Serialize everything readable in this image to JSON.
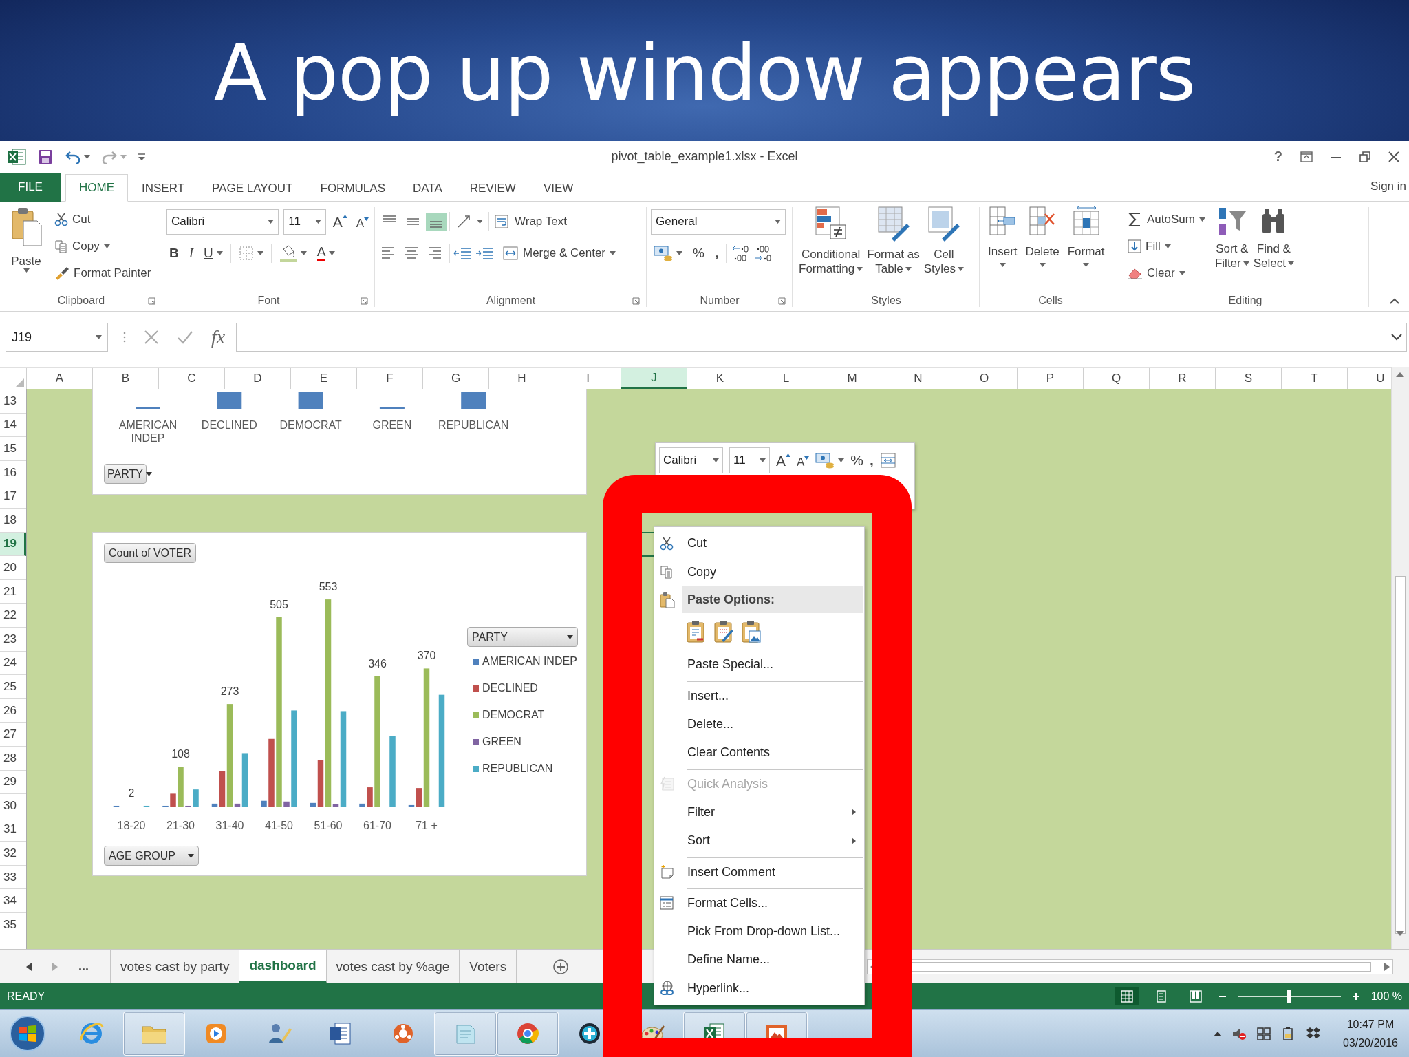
{
  "slide": {
    "title": "A pop up window appears"
  },
  "window": {
    "title": "pivot_table_example1.xlsx - Excel",
    "help": "?"
  },
  "ribbon_tabs": [
    {
      "label": "FILE",
      "kind": "file",
      "selected": false
    },
    {
      "label": "HOME",
      "kind": "tab",
      "selected": true
    },
    {
      "label": "INSERT",
      "kind": "tab",
      "selected": false
    },
    {
      "label": "PAGE LAYOUT",
      "kind": "tab",
      "selected": false
    },
    {
      "label": "FORMULAS",
      "kind": "tab",
      "selected": false
    },
    {
      "label": "DATA",
      "kind": "tab",
      "selected": false
    },
    {
      "label": "REVIEW",
      "kind": "tab",
      "selected": false
    },
    {
      "label": "VIEW",
      "kind": "tab",
      "selected": false
    }
  ],
  "account": {
    "sign_in": "Sign in"
  },
  "ribbon": {
    "clipboard": {
      "label": "Clipboard",
      "paste": "Paste",
      "cut": "Cut",
      "copy": "Copy",
      "format_painter": "Format Painter"
    },
    "font": {
      "label": "Font",
      "font_name": "Calibri",
      "font_size": "11",
      "grow": "A",
      "shrink": "A",
      "bold": "B",
      "italic": "I",
      "underline": "U",
      "font_color": "A"
    },
    "alignment": {
      "label": "Alignment",
      "vertical_align": [
        {
          "selected": false
        },
        {
          "selected": false
        },
        {
          "selected": true
        }
      ],
      "wrap_text": "Wrap Text",
      "merge_center": "Merge & Center"
    },
    "number": {
      "label": "Number",
      "format": "General",
      "percent": "%",
      "comma": ","
    },
    "styles": {
      "label": "Styles",
      "buttons": [
        {
          "lines": [
            "Conditional",
            "Formatting"
          ]
        },
        {
          "lines": [
            "Format as",
            "Table"
          ]
        },
        {
          "lines": [
            "Cell",
            "Styles"
          ]
        }
      ]
    },
    "cells": {
      "label": "Cells",
      "buttons": [
        "Insert",
        "Delete",
        "Format"
      ]
    },
    "editing": {
      "label": "Editing",
      "autosum": "AutoSum",
      "fill": "Fill",
      "clear": "Clear",
      "sort_filter": [
        "Sort &",
        "Filter"
      ],
      "find_select": [
        "Find &",
        "Select"
      ]
    }
  },
  "formula_bar": {
    "name_box": "J19",
    "function_label": "fx"
  },
  "sheet": {
    "columns": [
      {
        "label": "A",
        "selected": false
      },
      {
        "label": "B",
        "selected": false
      },
      {
        "label": "C",
        "selected": false
      },
      {
        "label": "D",
        "selected": false
      },
      {
        "label": "E",
        "selected": false
      },
      {
        "label": "F",
        "selected": false
      },
      {
        "label": "G",
        "selected": false
      },
      {
        "label": "H",
        "selected": false
      },
      {
        "label": "I",
        "selected": false
      },
      {
        "label": "J",
        "selected": true
      },
      {
        "label": "K",
        "selected": false
      },
      {
        "label": "L",
        "selected": false
      },
      {
        "label": "M",
        "selected": false
      },
      {
        "label": "N",
        "selected": false
      },
      {
        "label": "O",
        "selected": false
      },
      {
        "label": "P",
        "selected": false
      },
      {
        "label": "Q",
        "selected": false
      },
      {
        "label": "R",
        "selected": false
      },
      {
        "label": "S",
        "selected": false
      },
      {
        "label": "T",
        "selected": false
      },
      {
        "label": "U",
        "selected": false
      }
    ],
    "rows": [
      {
        "label": "13",
        "selected": false
      },
      {
        "label": "14",
        "selected": false
      },
      {
        "label": "15",
        "selected": false
      },
      {
        "label": "16",
        "selected": false
      },
      {
        "label": "17",
        "selected": false
      },
      {
        "label": "18",
        "selected": false
      },
      {
        "label": "19",
        "selected": true
      },
      {
        "label": "20",
        "selected": false
      },
      {
        "label": "21",
        "selected": false
      },
      {
        "label": "22",
        "selected": false
      },
      {
        "label": "23",
        "selected": false
      },
      {
        "label": "24",
        "selected": false
      },
      {
        "label": "25",
        "selected": false
      },
      {
        "label": "26",
        "selected": false
      },
      {
        "label": "27",
        "selected": false
      },
      {
        "label": "28",
        "selected": false
      },
      {
        "label": "29",
        "selected": false
      },
      {
        "label": "30",
        "selected": false
      },
      {
        "label": "31",
        "selected": false
      },
      {
        "label": "32",
        "selected": false
      },
      {
        "label": "33",
        "selected": false
      },
      {
        "label": "34",
        "selected": false
      },
      {
        "label": "35",
        "selected": false
      }
    ]
  },
  "party_chart": {
    "filter_button": "PARTY",
    "categories": [
      {
        "label": "AMERICAN INDEP",
        "kind": "thin"
      },
      {
        "label": "DECLINED",
        "kind": "block"
      },
      {
        "label": "DEMOCRAT",
        "kind": "block"
      },
      {
        "label": "GREEN",
        "kind": "thin"
      },
      {
        "label": "REPUBLICAN",
        "kind": "block"
      }
    ]
  },
  "age_chart": {
    "value_button": "Count of VOTER",
    "legend_button": "PARTY",
    "axis_button": "AGE GROUP",
    "categories": [
      "18-20",
      "21-30",
      "31-40",
      "41-50",
      "51-60",
      "61-70",
      "71 +"
    ],
    "legend": [
      {
        "name": "AMERICAN INDEP",
        "color": "#4f81bd"
      },
      {
        "name": "DECLINED",
        "color": "#c0504d"
      },
      {
        "name": "DEMOCRAT",
        "color": "#9bbb59"
      },
      {
        "name": "GREEN",
        "color": "#8064a2"
      },
      {
        "name": "REPUBLICAN",
        "color": "#4bacc6"
      }
    ],
    "total_labels": [
      "2",
      "108",
      "273",
      "505",
      "553",
      "346",
      "370"
    ]
  },
  "mini_toolbar": {
    "font_name": "Calibri",
    "font_size": "11",
    "grow": "A",
    "shrink": "A",
    "percent": "%",
    "comma": ","
  },
  "context_menu": {
    "items": [
      {
        "kind": "item",
        "label": "Cut",
        "disabled": false,
        "submenu": false,
        "divider_above": false
      },
      {
        "kind": "item",
        "label": "Copy",
        "disabled": false,
        "submenu": false,
        "divider_above": false
      },
      {
        "kind": "header",
        "label": "Paste Options:"
      },
      {
        "kind": "paste_icons"
      },
      {
        "kind": "item",
        "label": "Paste Special...",
        "disabled": false,
        "submenu": false,
        "divider_above": false
      },
      {
        "kind": "item",
        "label": "Insert...",
        "disabled": false,
        "submenu": false,
        "divider_above": true
      },
      {
        "kind": "item",
        "label": "Delete...",
        "disabled": false,
        "submenu": false,
        "divider_above": false
      },
      {
        "kind": "item",
        "label": "Clear Contents",
        "disabled": false,
        "submenu": false,
        "divider_above": false
      },
      {
        "kind": "item",
        "label": "Quick Analysis",
        "disabled": true,
        "submenu": false,
        "divider_above": true
      },
      {
        "kind": "item",
        "label": "Filter",
        "disabled": false,
        "submenu": true,
        "divider_above": false
      },
      {
        "kind": "item",
        "label": "Sort",
        "disabled": false,
        "submenu": true,
        "divider_above": false
      },
      {
        "kind": "item",
        "label": "Insert Comment",
        "disabled": false,
        "submenu": false,
        "divider_above": true
      },
      {
        "kind": "item",
        "label": "Format Cells...",
        "disabled": false,
        "submenu": false,
        "divider_above": true
      },
      {
        "kind": "item",
        "label": "Pick From Drop-down List...",
        "disabled": false,
        "submenu": false,
        "divider_above": false
      },
      {
        "kind": "item",
        "label": "Define Name...",
        "disabled": false,
        "submenu": false,
        "divider_above": false
      },
      {
        "kind": "item",
        "label": "Hyperlink...",
        "disabled": false,
        "submenu": false,
        "divider_above": false
      }
    ]
  },
  "sheet_tabs": {
    "more": "...",
    "tabs": [
      {
        "label": "votes cast by party",
        "selected": false
      },
      {
        "label": "dashboard",
        "selected": true
      },
      {
        "label": "votes cast by %age",
        "selected": false
      },
      {
        "label": "Voters",
        "selected": false
      }
    ]
  },
  "status_bar": {
    "mode": "READY",
    "views": [
      {
        "selected": true
      },
      {
        "selected": false
      },
      {
        "selected": false
      }
    ],
    "zoom": {
      "level": 0.5,
      "label": "100 %"
    }
  },
  "taskbar": {
    "apps": [
      {
        "running": false
      },
      {
        "running": true
      },
      {
        "running": false
      },
      {
        "running": false
      },
      {
        "running": false
      },
      {
        "running": false
      },
      {
        "running": true
      },
      {
        "running": true
      },
      {
        "running": false
      },
      {
        "running": false
      },
      {
        "running": true
      },
      {
        "running": true
      }
    ],
    "time": "10:47 PM",
    "date": "03/20/2016"
  }
}
